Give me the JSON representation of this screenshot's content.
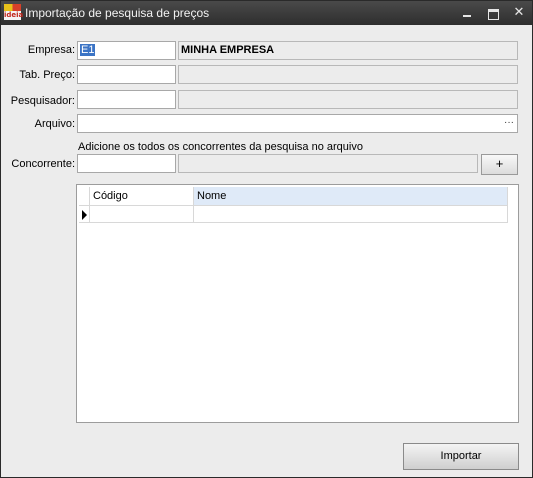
{
  "window": {
    "title": "Importação de pesquisa de preços",
    "app_icon_text": "ideia",
    "min_icon": "minimize-icon",
    "max_icon": "maximize-icon",
    "close_icon": "close-icon",
    "close_glyph": "✕"
  },
  "form": {
    "empresa": {
      "label": "Empresa:",
      "code": "E1",
      "name": "MINHA EMPRESA"
    },
    "tab_preco": {
      "label": "Tab. Preço:",
      "code": "",
      "name": ""
    },
    "pesquisador": {
      "label": "Pesquisador:",
      "code": "",
      "name": ""
    },
    "arquivo": {
      "label": "Arquivo:",
      "value": "",
      "browse": "···"
    },
    "hint": "Adicione os todos os concorrentes da pesquisa no arquivo",
    "concorrente": {
      "label": "Concorrente:",
      "code": "",
      "name": "",
      "add_label": "+"
    }
  },
  "grid": {
    "columns": [
      "Código",
      "Nome"
    ],
    "rows": [
      {
        "codigo": "",
        "nome": ""
      }
    ]
  },
  "actions": {
    "import_label": "Importar"
  }
}
